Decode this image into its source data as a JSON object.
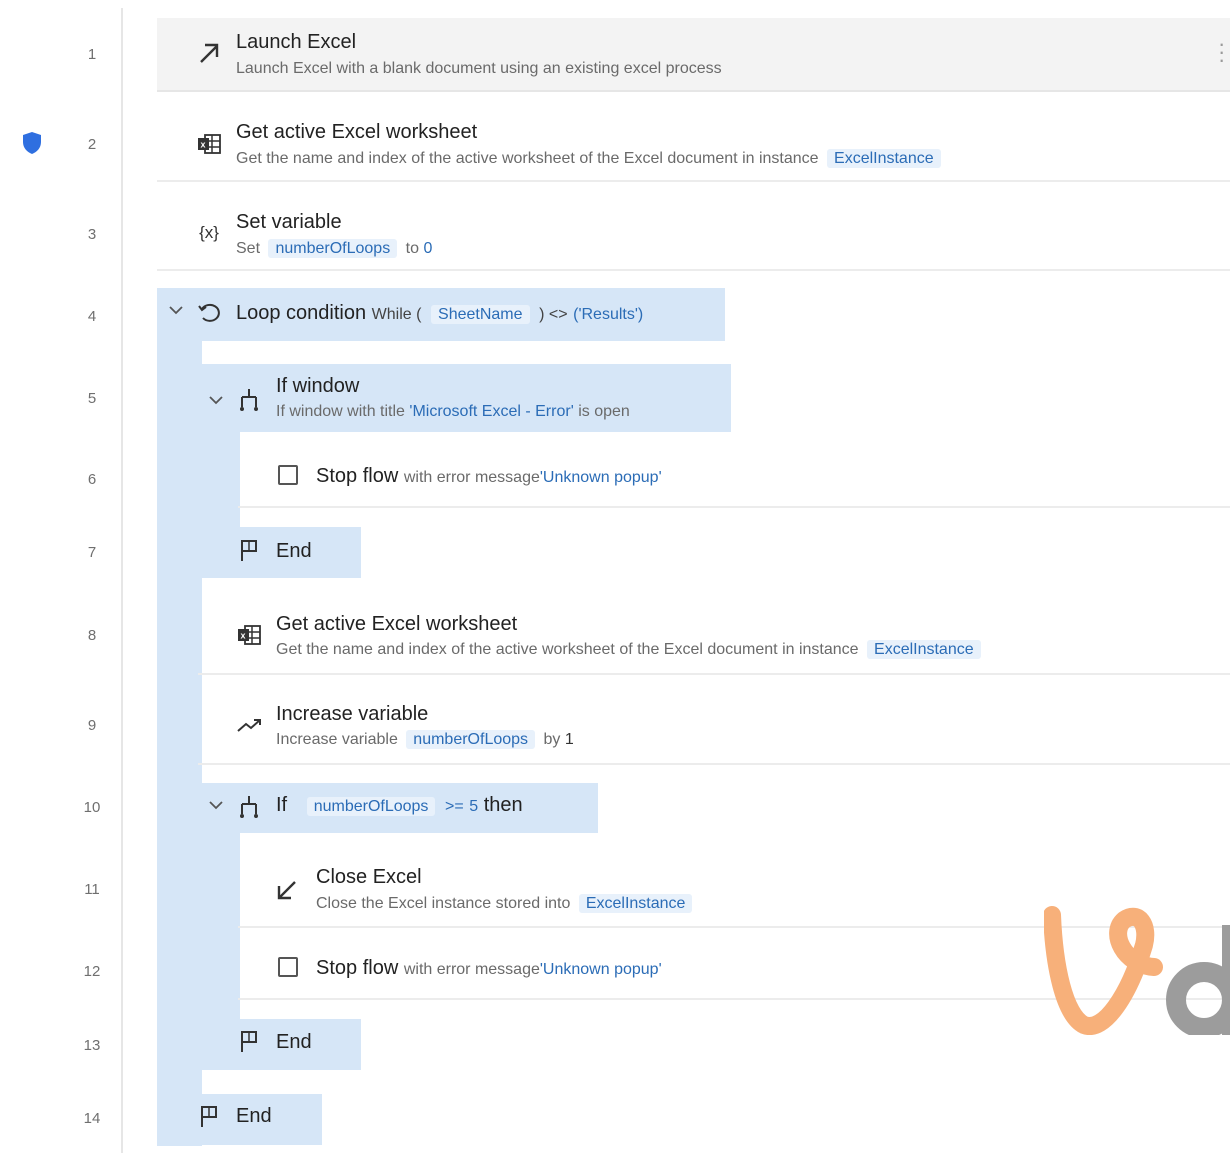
{
  "line_numbers": [
    "1",
    "2",
    "3",
    "4",
    "5",
    "6",
    "7",
    "8",
    "9",
    "10",
    "11",
    "12",
    "13",
    "14"
  ],
  "steps": {
    "s1": {
      "title": "Launch Excel",
      "sub": "Launch Excel with a blank document using an existing excel process"
    },
    "s2": {
      "title": "Get active Excel worksheet",
      "sub": "Get the name and index of the active worksheet of the Excel document in instance",
      "var": "ExcelInstance"
    },
    "s3": {
      "title": "Set variable",
      "sub_prefix": "Set",
      "var": "numberOfLoops",
      "sub_mid": "to",
      "value": "0"
    },
    "s4": {
      "title": "Loop condition",
      "cond_prefix": "While (",
      "var": "SheetName",
      "cond_op": ") <>",
      "cond_value": "('Results')"
    },
    "s5": {
      "title": "If window",
      "sub_prefix": "If window with title",
      "window_title": "'Microsoft Excel - Error'",
      "sub_suffix": "is open"
    },
    "s6": {
      "title": "Stop flow",
      "sub_prefix": "with error message",
      "message": "'Unknown popup'"
    },
    "s7": {
      "title": "End"
    },
    "s8": {
      "title": "Get active Excel worksheet",
      "sub": "Get the name and index of the active worksheet of the Excel document in instance",
      "var": "ExcelInstance"
    },
    "s9": {
      "title": "Increase variable",
      "sub_prefix": "Increase variable",
      "var": "numberOfLoops",
      "sub_mid": "by",
      "value": "1"
    },
    "s10": {
      "title": "If",
      "var": "numberOfLoops",
      "op": ">=",
      "value": "5",
      "suffix": "then"
    },
    "s11": {
      "title": "Close Excel",
      "sub": "Close the Excel instance stored into",
      "var": "ExcelInstance"
    },
    "s12": {
      "title": "Stop flow",
      "sub_prefix": "with error message",
      "message": "'Unknown popup'"
    },
    "s13": {
      "title": "End"
    },
    "s14": {
      "title": "End"
    }
  },
  "icons": {
    "s1": "launch-arrow-icon",
    "s2": "excel-worksheet-icon",
    "s3": "variable-icon",
    "s4": "loop-icon",
    "s5": "condition-icon",
    "s6": "stop-checkbox-icon",
    "s7": "flag-icon",
    "s8": "excel-worksheet-icon",
    "s9": "trend-up-icon",
    "s10": "condition-icon",
    "s11": "close-arrow-icon",
    "s12": "stop-checkbox-icon",
    "s13": "flag-icon",
    "s14": "flag-icon",
    "gutter": "shield-icon"
  },
  "colors": {
    "block_highlight": "#d6e6f7",
    "variable_text": "#2b6cb6",
    "variable_bg": "#e8f1fb",
    "breakpoint_shield": "#2f6fe0",
    "watermark_orange": "#f7b07a",
    "watermark_gray": "#9c9c9c"
  }
}
